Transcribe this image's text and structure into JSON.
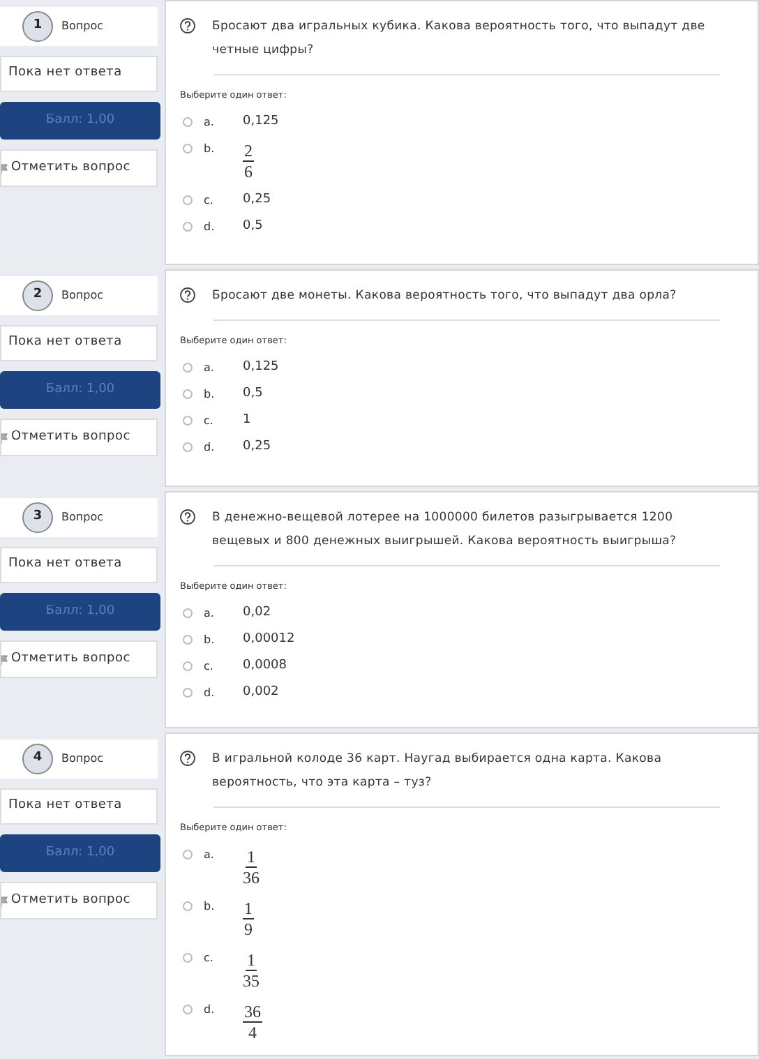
{
  "questions": [
    {
      "number": "1",
      "label": "Вопрос",
      "status": "Пока нет ответа",
      "score": "Балл: 1,00",
      "flag": "Отметить вопрос",
      "text": "Бросают два игральных кубика. Какова вероятность того, что выпадут две четные цифры?",
      "prompt": "Выберите один ответ:",
      "options": [
        {
          "letter": "a.",
          "kind": "text",
          "value": "0,125",
          "selected": false
        },
        {
          "letter": "b.",
          "kind": "fraction",
          "numerator": "2",
          "denominator": "6",
          "selected": false
        },
        {
          "letter": "c.",
          "kind": "text",
          "value": "0,25",
          "selected": false
        },
        {
          "letter": "d.",
          "kind": "text",
          "value": "0,5",
          "selected": false
        }
      ]
    },
    {
      "number": "2",
      "label": "Вопрос",
      "status": "Пока нет ответа",
      "score": "Балл: 1,00",
      "flag": "Отметить вопрос",
      "text": "Бросают две монеты. Какова вероятность того, что выпадут два орла?",
      "prompt": "Выберите один ответ:",
      "options": [
        {
          "letter": "a.",
          "kind": "text",
          "value": "0,125",
          "selected": false
        },
        {
          "letter": "b.",
          "kind": "text",
          "value": "0,5",
          "selected": false
        },
        {
          "letter": "c.",
          "kind": "text",
          "value": "1",
          "selected": false
        },
        {
          "letter": "d.",
          "kind": "text",
          "value": "0,25",
          "selected": false
        }
      ]
    },
    {
      "number": "3",
      "label": "Вопрос",
      "status": "Пока нет ответа",
      "score": "Балл: 1,00",
      "flag": "Отметить вопрос",
      "text": "В денежно-вещевой лотерее на 1000000 билетов разыгрывается 1200 вещевых и 800 денежных выигрышей. Какова вероятность выигрыша?",
      "prompt": "Выберите один ответ:",
      "options": [
        {
          "letter": "a.",
          "kind": "text",
          "value": "0,02",
          "selected": false
        },
        {
          "letter": "b.",
          "kind": "text",
          "value": "0,00012",
          "selected": false
        },
        {
          "letter": "c.",
          "kind": "text",
          "value": "0,0008",
          "selected": false
        },
        {
          "letter": "d.",
          "kind": "text",
          "value": "0,002",
          "selected": false
        }
      ]
    },
    {
      "number": "4",
      "label": "Вопрос",
      "status": "Пока нет ответа",
      "score": "Балл: 1,00",
      "flag": "Отметить вопрос",
      "text": "В игральной колоде 36 карт. Наугад выбирается одна карта. Какова вероятность, что эта карта – туз?",
      "prompt": "Выберите один ответ:",
      "options": [
        {
          "letter": "a.",
          "kind": "fraction",
          "numerator": "1",
          "denominator": "36",
          "selected": false
        },
        {
          "letter": "b.",
          "kind": "fraction",
          "numerator": "1",
          "denominator": "9",
          "selected": false
        },
        {
          "letter": "c.",
          "kind": "fraction",
          "numerator": "1",
          "denominator": "35",
          "selected": false
        },
        {
          "letter": "d.",
          "kind": "fraction",
          "numerator": "36",
          "denominator": "4",
          "selected": false
        }
      ]
    }
  ]
}
